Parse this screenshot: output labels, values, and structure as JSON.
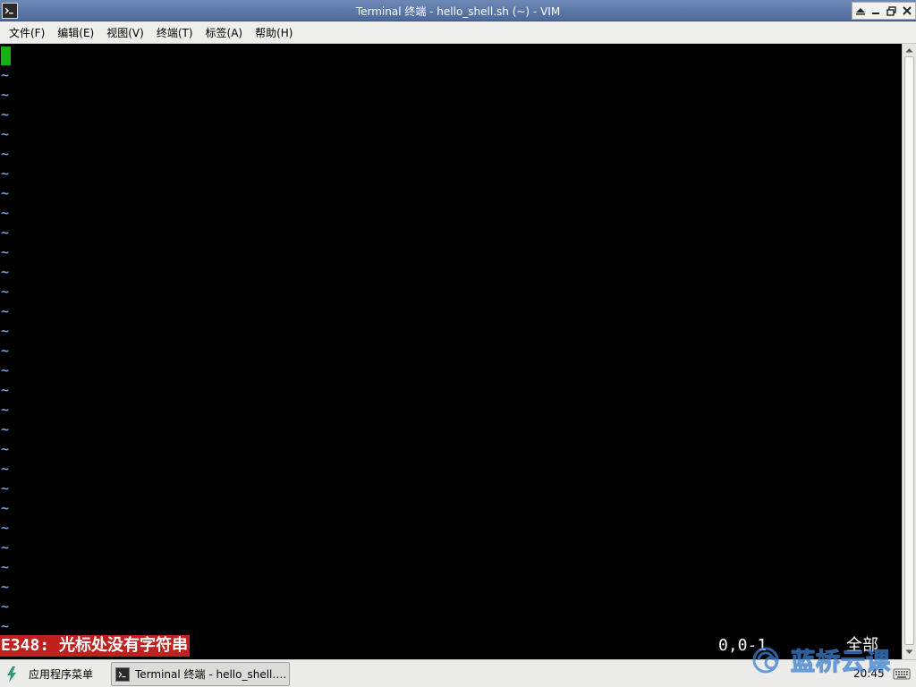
{
  "window": {
    "title": "Terminal 终端 - hello_shell.sh (~) - VIM",
    "controls": [
      "shade",
      "minimize",
      "maximize",
      "close"
    ]
  },
  "menubar": {
    "items": [
      {
        "label": "文件(F)"
      },
      {
        "label": "编辑(E)"
      },
      {
        "label": "视图(V)"
      },
      {
        "label": "终端(T)"
      },
      {
        "label": "标签(A)"
      },
      {
        "label": "帮助(H)"
      }
    ]
  },
  "vim": {
    "empty_line_marker": "~",
    "empty_line_count": 29,
    "error_message": "E348: 光标处没有字符串",
    "cursor_position": "0,0-1",
    "scroll_position": "全部",
    "colors": {
      "cursor": "#15b015",
      "tilde": "#6d9ad6",
      "error_bg": "#c0211f"
    }
  },
  "taskbar": {
    "start_menu_label": "应用程序菜单",
    "tasks": [
      {
        "label": "Terminal 终端 - hello_shell.…",
        "icon": "terminal-icon"
      }
    ],
    "clock": "20:45"
  },
  "watermark": {
    "text": "蓝桥云课"
  }
}
